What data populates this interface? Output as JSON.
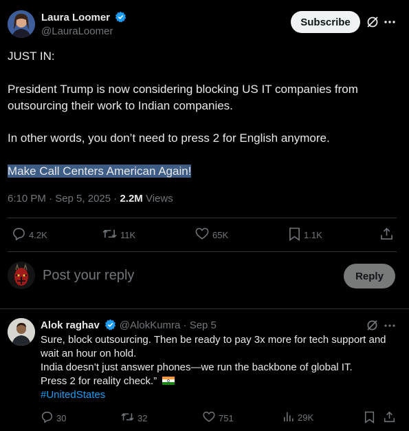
{
  "post": {
    "author_name": "Laura Loomer",
    "author_handle": "@LauraLoomer",
    "subscribe_label": "Subscribe",
    "lines": [
      "JUST IN:",
      "President Trump is now considering blocking US IT companies from",
      "outsourcing their work to Indian companies.",
      "In other words, you don’t need to press 2 for English anymore.",
      "Make Call Centers American Again!"
    ],
    "time_date": "6:10 PM · Sep 5, 2025 · ",
    "views_count": "2.2M",
    "views_label": " Views",
    "actions": {
      "replies": "4.2K",
      "reposts": "11K",
      "likes": "65K",
      "bookmarks": "1.1K"
    }
  },
  "compose": {
    "placeholder": "Post your reply",
    "reply_label": "Reply"
  },
  "reply": {
    "author_name": "Alok raghav",
    "author_handle": "@AlokKumra",
    "date": " · Sep 5",
    "lines": [
      "Sure, block outsourcing. Then be ready to pay 3x more for tech support and",
      "wait an hour on hold.",
      "India doesn’t just answer phones—we run the backbone of global IT.",
      "Press 2 for reality check.”"
    ],
    "hashtag": "#UnitedStates",
    "actions": {
      "replies": "30",
      "reposts": "32",
      "likes": "751",
      "views": "29K"
    }
  },
  "colors": {
    "background": "#000000",
    "text": "#e7e9ea",
    "muted": "#71767b",
    "accent": "#1d9bf0",
    "highlight": "#3e5d86"
  },
  "icons": [
    "verified-badge-icon",
    "grok-icon",
    "more-icon",
    "reply-icon",
    "repost-icon",
    "like-icon",
    "bookmark-icon",
    "share-icon",
    "views-icon",
    "india-flag-icon"
  ]
}
